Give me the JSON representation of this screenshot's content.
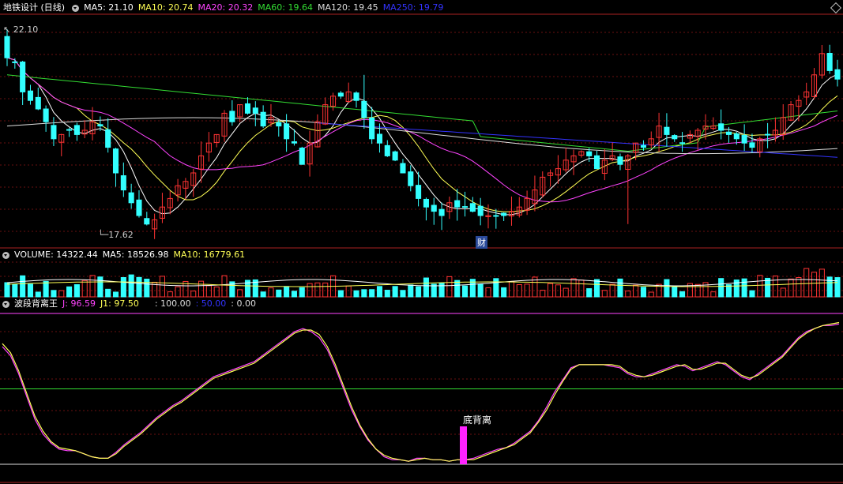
{
  "main": {
    "title": "地铁设计 (日线)",
    "ma": [
      {
        "label": "MA5: 21.10",
        "color": "#ffffff"
      },
      {
        "label": "MA10: 20.74",
        "color": "#ffff55"
      },
      {
        "label": "MA20: 20.32",
        "color": "#ff44ff"
      },
      {
        "label": "MA60: 19.64",
        "color": "#33dd33"
      },
      {
        "label": "MA120: 19.45",
        "color": "#dddddd"
      },
      {
        "label": "MA250: 19.79",
        "color": "#3333ff"
      }
    ],
    "high_label": "22.10",
    "low_label": "17.62",
    "fin_marker": "财"
  },
  "volume": {
    "title": "VOLUME: 14322.44",
    "ma5": "MA5: 18526.98",
    "ma10": "MA10: 16779.61"
  },
  "indicator": {
    "title": "波段背离王",
    "j": "J: 96.59",
    "j1": "J1: 97.50",
    "v100": ": 100.00",
    "v50": ": 50.00",
    "v0": ": 0.00",
    "annotation": "底背离"
  },
  "colors": {
    "up": "#ff3333",
    "down": "#33ffff",
    "divider": "#aa2222",
    "grid": "#6a1010"
  },
  "chart_data": {
    "type": "candlestick",
    "closes": [
      21.6,
      21.5,
      20.8,
      20.6,
      20.4,
      20.1,
      19.7,
      19.8,
      19.9,
      19.8,
      19.9,
      20.1,
      20.0,
      19.5,
      18.9,
      18.5,
      18.2,
      17.9,
      17.7,
      17.8,
      18.1,
      18.3,
      18.6,
      18.7,
      18.9,
      19.3,
      19.6,
      19.8,
      20.3,
      20.1,
      20.5,
      20.3,
      20.3,
      20.0,
      20.2,
      20.0,
      19.7,
      19.6,
      19.1,
      19.6,
      20.1,
      20.5,
      20.7,
      20.7,
      20.8,
      20.6,
      20.2,
      19.7,
      19.6,
      19.3,
      19.2,
      18.9,
      18.6,
      18.3,
      18.1,
      18.0,
      17.9,
      18.2,
      18.1,
      18.1,
      18.0,
      17.9,
      17.9,
      17.9,
      17.9,
      18.0,
      18.1,
      18.3,
      18.5,
      18.8,
      18.9,
      19.0,
      19.2,
      19.3,
      19.4,
      19.3,
      19.0,
      19.2,
      19.3,
      19.1,
      19.3,
      19.6,
      19.5,
      19.7,
      20.0,
      19.8,
      19.7,
      19.6,
      19.8,
      19.9,
      20.0,
      20.0,
      19.9,
      19.8,
      19.7,
      19.6,
      19.5,
      19.7,
      19.8,
      19.9,
      20.2,
      20.5,
      20.6,
      20.8,
      21.2,
      21.7,
      21.3,
      21.1
    ],
    "j": [
      78,
      72,
      60,
      45,
      30,
      20,
      14,
      10,
      9,
      9,
      7,
      5,
      4,
      4,
      8,
      13,
      17,
      21,
      26,
      31,
      35,
      39,
      42,
      46,
      50,
      54,
      58,
      60,
      62,
      64,
      66,
      68,
      72,
      76,
      80,
      84,
      88,
      90,
      88,
      84,
      76,
      64,
      50,
      36,
      25,
      16,
      10,
      5,
      3,
      3,
      2,
      4,
      4,
      3,
      3,
      2,
      3,
      3,
      4,
      6,
      8,
      10,
      11,
      14,
      18,
      22,
      29,
      38,
      48,
      56,
      64,
      66,
      66,
      66,
      66,
      65,
      64,
      60,
      58,
      58,
      60,
      62,
      64,
      66,
      65,
      62,
      64,
      66,
      68,
      66,
      62,
      58,
      56,
      60,
      64,
      68,
      72,
      78,
      84,
      88,
      90,
      92,
      92,
      93
    ],
    "j1": [
      80,
      74,
      62,
      47,
      32,
      22,
      15,
      11,
      10,
      9,
      7,
      5,
      4,
      4,
      7,
      12,
      16,
      20,
      25,
      30,
      34,
      38,
      41,
      45,
      49,
      53,
      57,
      59,
      61,
      63,
      65,
      67,
      71,
      75,
      79,
      83,
      87,
      89,
      89,
      86,
      78,
      66,
      52,
      38,
      26,
      17,
      10,
      6,
      4,
      3,
      2,
      3,
      4,
      3,
      3,
      2,
      3,
      3,
      3,
      5,
      7,
      9,
      11,
      13,
      17,
      21,
      28,
      36,
      46,
      55,
      63,
      66,
      66,
      66,
      66,
      66,
      65,
      61,
      59,
      58,
      59,
      61,
      63,
      65,
      66,
      63,
      63,
      65,
      67,
      67,
      63,
      59,
      57,
      59,
      63,
      67,
      71,
      77,
      83,
      87,
      90,
      92,
      93,
      94
    ]
  }
}
